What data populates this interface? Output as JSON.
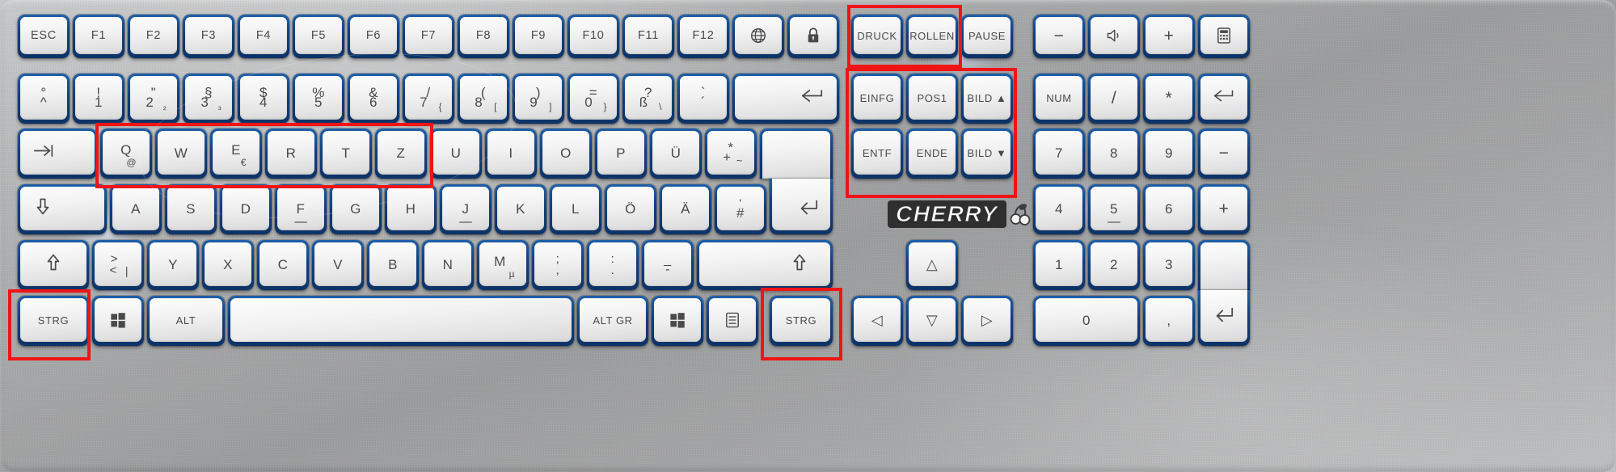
{
  "product": {
    "brand": "CHERRY",
    "layout": "German QWERTZ full-size keyboard",
    "body_color": "#adaeaf",
    "keycap_color": "#f0f0f0",
    "key_border_color": "#14528f",
    "legend_color": "#4a4a4a",
    "annotation_color": "#f01414"
  },
  "rows": {
    "function_row": [
      {
        "label": "ESC"
      },
      {
        "label": "F1"
      },
      {
        "label": "F2"
      },
      {
        "label": "F3"
      },
      {
        "label": "F4"
      },
      {
        "label": "F5"
      },
      {
        "label": "F6"
      },
      {
        "label": "F7"
      },
      {
        "label": "F8"
      },
      {
        "label": "F9"
      },
      {
        "label": "F10"
      },
      {
        "label": "F11"
      },
      {
        "label": "F12"
      },
      {
        "label": "globe-icon"
      },
      {
        "label": "lock-icon"
      }
    ],
    "number_row": [
      {
        "top": "°",
        "bottom": "^"
      },
      {
        "top": "!",
        "bottom": "1"
      },
      {
        "top": "\"",
        "bottom": "2",
        "alt": "²"
      },
      {
        "top": "§",
        "bottom": "3",
        "alt": "³"
      },
      {
        "top": "$",
        "bottom": "4"
      },
      {
        "top": "%",
        "bottom": "5"
      },
      {
        "top": "&",
        "bottom": "6"
      },
      {
        "top": "/",
        "bottom": "7",
        "alt": "{"
      },
      {
        "top": "(",
        "bottom": "8",
        "alt": "["
      },
      {
        "top": ")",
        "bottom": "9",
        "alt": "]"
      },
      {
        "top": "=",
        "bottom": "0",
        "alt": "}"
      },
      {
        "top": "?",
        "bottom": "ß",
        "alt": "\\"
      },
      {
        "top": "`",
        "bottom": "´"
      },
      {
        "label": "backspace-arrow"
      }
    ],
    "tab_row": [
      {
        "label": "tab-icon"
      },
      {
        "label": "Q",
        "alt": "@"
      },
      {
        "label": "W"
      },
      {
        "label": "E",
        "alt": "€"
      },
      {
        "label": "R"
      },
      {
        "label": "T"
      },
      {
        "label": "Z"
      },
      {
        "label": "U"
      },
      {
        "label": "I"
      },
      {
        "label": "O"
      },
      {
        "label": "P"
      },
      {
        "label": "Ü"
      },
      {
        "top": "*",
        "bottom": "+",
        "alt": "~"
      },
      {
        "label": "enter-icon"
      }
    ],
    "home_row": [
      {
        "label": "caps-lock-icon"
      },
      {
        "label": "A"
      },
      {
        "label": "S"
      },
      {
        "label": "D"
      },
      {
        "label": "F"
      },
      {
        "label": "G"
      },
      {
        "label": "H"
      },
      {
        "label": "J"
      },
      {
        "label": "K"
      },
      {
        "label": "L"
      },
      {
        "label": "Ö"
      },
      {
        "label": "Ä"
      },
      {
        "top": "'",
        "bottom": "#"
      }
    ],
    "shift_row": [
      {
        "label": "shift-up-icon"
      },
      {
        "top": ">",
        "bottom": "<",
        "alt": "|"
      },
      {
        "label": "Y"
      },
      {
        "label": "X"
      },
      {
        "label": "C"
      },
      {
        "label": "V"
      },
      {
        "label": "B"
      },
      {
        "label": "N"
      },
      {
        "label": "M",
        "alt": "µ"
      },
      {
        "top": ";",
        "bottom": ","
      },
      {
        "top": ":",
        "bottom": "."
      },
      {
        "top": "_",
        "bottom": "-"
      },
      {
        "label": "shift-up-icon-right"
      }
    ],
    "bottom_row": [
      {
        "label": "STRG"
      },
      {
        "label": "windows-icon"
      },
      {
        "label": "ALT"
      },
      {
        "label": "spacebar"
      },
      {
        "label": "ALT GR"
      },
      {
        "label": "windows-icon-right"
      },
      {
        "label": "menu-icon"
      },
      {
        "label": "STRG"
      }
    ]
  },
  "nav_cluster": {
    "top": [
      "DRUCK",
      "ROLLEN",
      "PAUSE"
    ],
    "middle": [
      "EINFG",
      "POS1",
      "BILD ▲"
    ],
    "lower": [
      "ENTF",
      "ENDE",
      "BILD ▼"
    ],
    "arrows": {
      "up": "△",
      "left": "◁",
      "down": "▽",
      "right": "▷"
    }
  },
  "numpad": {
    "row1": [
      "−",
      "speaker-mute-icon",
      "+",
      "calculator-icon"
    ],
    "row2": [
      "NUM",
      "/",
      "*",
      "backspace-arrow"
    ],
    "row3": [
      "7",
      "8",
      "9",
      "−"
    ],
    "row4": [
      "4",
      "5",
      "6",
      "+"
    ],
    "row5": [
      "1",
      "2",
      "3"
    ],
    "row6": [
      "0",
      ","
    ],
    "enter": "enter-icon"
  },
  "annotations": [
    {
      "name": "qwertz-highlight",
      "covers": "Q W E R T Z keys"
    },
    {
      "name": "druck-rollen-highlight",
      "covers": "DRUCK and ROLLEN keys"
    },
    {
      "name": "nav-block-highlight",
      "covers": "EINFG POS1 BILD▲ ENTF ENDE BILD▼"
    },
    {
      "name": "left-strg-highlight",
      "covers": "left STRG key"
    },
    {
      "name": "right-strg-highlight",
      "covers": "right STRG key"
    }
  ],
  "icons": {
    "globe": "⊕",
    "lock": "🔒",
    "backspace": "⇦",
    "tab": "⇥",
    "enter": "⏎",
    "caps": "⇩",
    "shift": "⇧",
    "windows": "⊞",
    "menu": "▤",
    "speaker": "◁)",
    "calculator": "▦"
  }
}
